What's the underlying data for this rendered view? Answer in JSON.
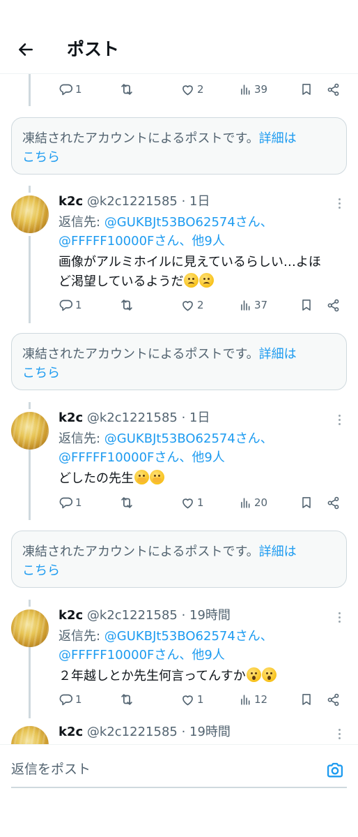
{
  "header": {
    "back_icon": "arrow-left-icon",
    "title": "ポスト"
  },
  "first_actions": {
    "reply": "1",
    "repost": "",
    "like": "2",
    "views": "39"
  },
  "notices": [
    {
      "text": "凍結されたアカウントによるポストです。",
      "link": "詳細は",
      "link_cont": "こちら"
    },
    {
      "text": "凍結されたアカウントによるポストです。",
      "link": "詳細は",
      "link_cont": "こちら"
    },
    {
      "text": "凍結されたアカウントによるポストです。",
      "link": "詳細は",
      "link_cont": "こちら"
    }
  ],
  "tweets": [
    {
      "name": "k2c",
      "handle": "@k2c1221585 · 1日",
      "reply_prefix": "返信先: ",
      "reply_to_1": "@GUKBJt53BO62574さん、",
      "reply_to_2": "@FFFFF10000Fさん、他9人",
      "text_line1": "画像がアルミホイルに見えているらしい…よほ",
      "text_line2": "ど渇望しているようだ",
      "emoji": "worried-face",
      "reply_count": "1",
      "like_count": "2",
      "view_count": "37"
    },
    {
      "name": "k2c",
      "handle": "@k2c1221585 · 1日",
      "reply_prefix": "返信先: ",
      "reply_to_1": "@GUKBJt53BO62574さん、",
      "reply_to_2": "@FFFFF10000Fさん、他9人",
      "text_line1": "どしたの先生",
      "emoji": "face-with-hand-over-mouth",
      "reply_count": "1",
      "like_count": "1",
      "view_count": "20"
    },
    {
      "name": "k2c",
      "handle": "@k2c1221585 · 19時間",
      "reply_prefix": "返信先: ",
      "reply_to_1": "@GUKBJt53BO62574さん、",
      "reply_to_2": "@FFFFF10000Fさん、他9人",
      "text_line1": "２年越しとか先生何言ってんすか",
      "emoji": "face-with-open-mouth",
      "reply_count": "1",
      "like_count": "1",
      "view_count": "12"
    },
    {
      "name": "k2c",
      "handle": "@k2c1221585 · 19時間"
    }
  ],
  "composer": {
    "placeholder": "返信をポスト",
    "camera_icon": "camera-icon"
  },
  "colors": {
    "accent": "#1d9bf0",
    "text": "#0f1419",
    "muted": "#536471",
    "border": "#cfd9de"
  }
}
